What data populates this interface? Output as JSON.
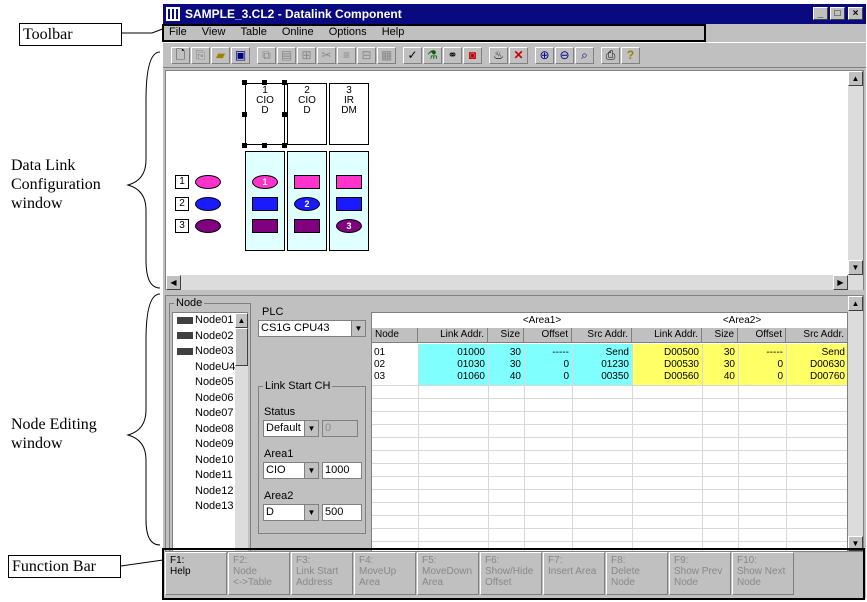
{
  "annotations": {
    "toolbar": "Toolbar",
    "config_l1": "Data Link",
    "config_l2": "Configuration",
    "config_l3": "window",
    "edit_l1": "Node  Editing",
    "edit_l2": "window",
    "function_bar": "Function Bar"
  },
  "window": {
    "title": "SAMPLE_3.CL2 - Datalink Component",
    "controls": [
      "_",
      "□",
      "×"
    ]
  },
  "menu": [
    "File",
    "View",
    "Table",
    "Online",
    "Options",
    "Help"
  ],
  "toolbar_icons": [
    "new-file-icon",
    "open-file-icon",
    "open-folder-icon",
    "save-icon",
    "copy-icon",
    "paste-icon",
    "link-icon",
    "cut-icon",
    "align-icon",
    "table-icon",
    "grid-icon",
    "check-icon",
    "wizard-icon",
    "connect-icon",
    "monitor-icon",
    "transfer-icon",
    "delete-icon",
    "zoom-in-icon",
    "zoom-out-icon",
    "zoom-fit-icon",
    "print-icon",
    "help-icon"
  ],
  "config": {
    "nodes": [
      {
        "num": "1",
        "area1": "CIO",
        "area2": "D"
      },
      {
        "num": "2",
        "area1": "CIO",
        "area2": "D"
      },
      {
        "num": "3",
        "area1": "IR",
        "area2": "DM"
      }
    ],
    "rows": [
      "1",
      "2",
      "3"
    ],
    "row_colors": [
      "#ff33cc",
      "#1a1aff",
      "#800080"
    ],
    "marker_labels": [
      "1",
      "2",
      "3"
    ]
  },
  "edit": {
    "node_group": "Node",
    "node_items": [
      "Node01",
      "Node02",
      "Node03",
      "NodeU4",
      "Node05",
      "Node06",
      "Node07",
      "Node08",
      "Node09",
      "Node10",
      "Node11",
      "Node12",
      "Node13"
    ],
    "plc_group": "PLC",
    "plc_value": "CS1G CPU43",
    "link_start_ch": "Link Start CH",
    "status_label": "Status",
    "status_value": "Default",
    "status_field": "0",
    "area1_label": "Area1",
    "area1_type": "CIO",
    "area1_value": "1000",
    "area2_label": "Area2",
    "area2_type": "D",
    "area2_value": "500"
  },
  "grid": {
    "area1_header": "<Area1>",
    "area2_header": "<Area2>",
    "columns": [
      "Node",
      "Link Addr.",
      "Size",
      "Offset",
      "Src Addr.",
      "Link Addr.",
      "Size",
      "Offset",
      "Src Addr."
    ],
    "rows": [
      [
        "01",
        "01000",
        "30",
        "-----",
        "Send",
        "D00500",
        "30",
        "-----",
        "Send"
      ],
      [
        "02",
        "01030",
        "30",
        "0",
        "01230",
        "D00530",
        "30",
        "0",
        "D00630"
      ],
      [
        "03",
        "01060",
        "40",
        "0",
        "00350",
        "D00560",
        "40",
        "0",
        "D00760"
      ]
    ]
  },
  "function_keys": [
    {
      "key": "F1:",
      "l1": "Help",
      "l2": "",
      "enabled": true
    },
    {
      "key": "F2:",
      "l1": "Node",
      "l2": "<->Table",
      "enabled": false
    },
    {
      "key": "F3:",
      "l1": "Link Start",
      "l2": "Address",
      "enabled": false
    },
    {
      "key": "F4:",
      "l1": "MoveUp",
      "l2": "Area",
      "enabled": false
    },
    {
      "key": "F5:",
      "l1": "MoveDown",
      "l2": "Area",
      "enabled": false
    },
    {
      "key": "F6:",
      "l1": "Show/Hide",
      "l2": "Offset",
      "enabled": false
    },
    {
      "key": "F7:",
      "l1": "Insert Area",
      "l2": "",
      "enabled": false
    },
    {
      "key": "F8:",
      "l1": "Delete",
      "l2": "Node",
      "enabled": false
    },
    {
      "key": "F9:",
      "l1": "Show Prev",
      "l2": "Node",
      "enabled": false
    },
    {
      "key": "F10:",
      "l1": "Show Next",
      "l2": "Node",
      "enabled": false
    }
  ],
  "colors": {
    "title_bar": "#0a0a80",
    "area1_fill": "#80ffff",
    "area2_fill": "#ffff66",
    "node_column": "#e0ffff"
  }
}
